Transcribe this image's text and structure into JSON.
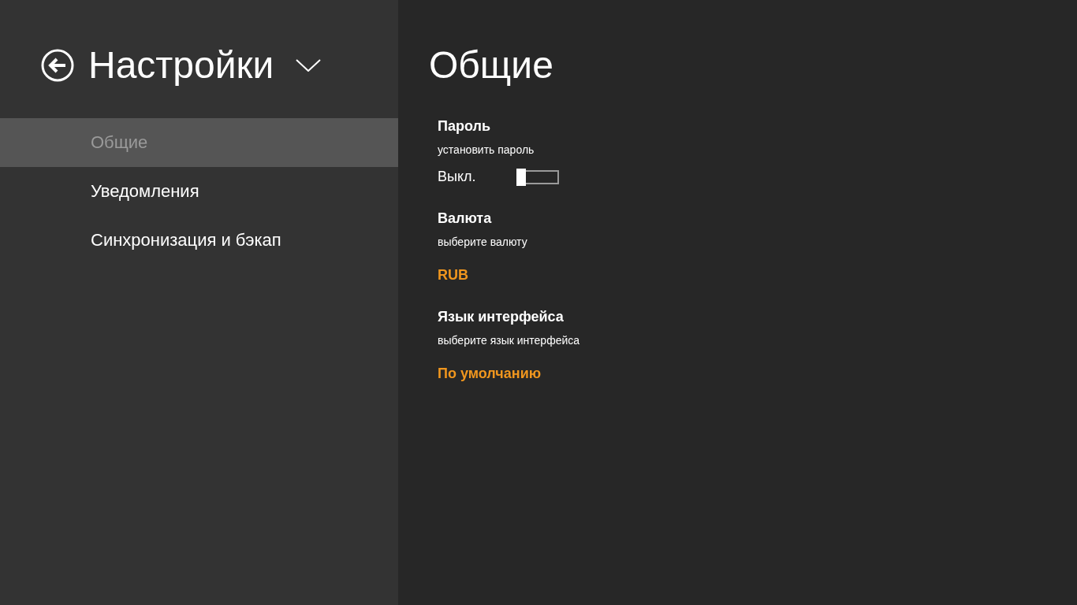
{
  "sidebar": {
    "title": "Настройки",
    "items": [
      {
        "label": "Общие",
        "selected": true
      },
      {
        "label": "Уведомления",
        "selected": false
      },
      {
        "label": "Синхронизация и бэкап",
        "selected": false
      }
    ]
  },
  "content": {
    "title": "Общие",
    "sections": [
      {
        "kind": "toggle",
        "heading": "Пароль",
        "description": "установить пароль",
        "state_label": "Выкл.",
        "on": false
      },
      {
        "kind": "picker",
        "heading": "Валюта",
        "description": "выберите валюту",
        "value": "RUB"
      },
      {
        "kind": "picker",
        "heading": "Язык интерфейса",
        "description": "выберите язык интерфейса",
        "value": "По умолчанию"
      }
    ]
  }
}
